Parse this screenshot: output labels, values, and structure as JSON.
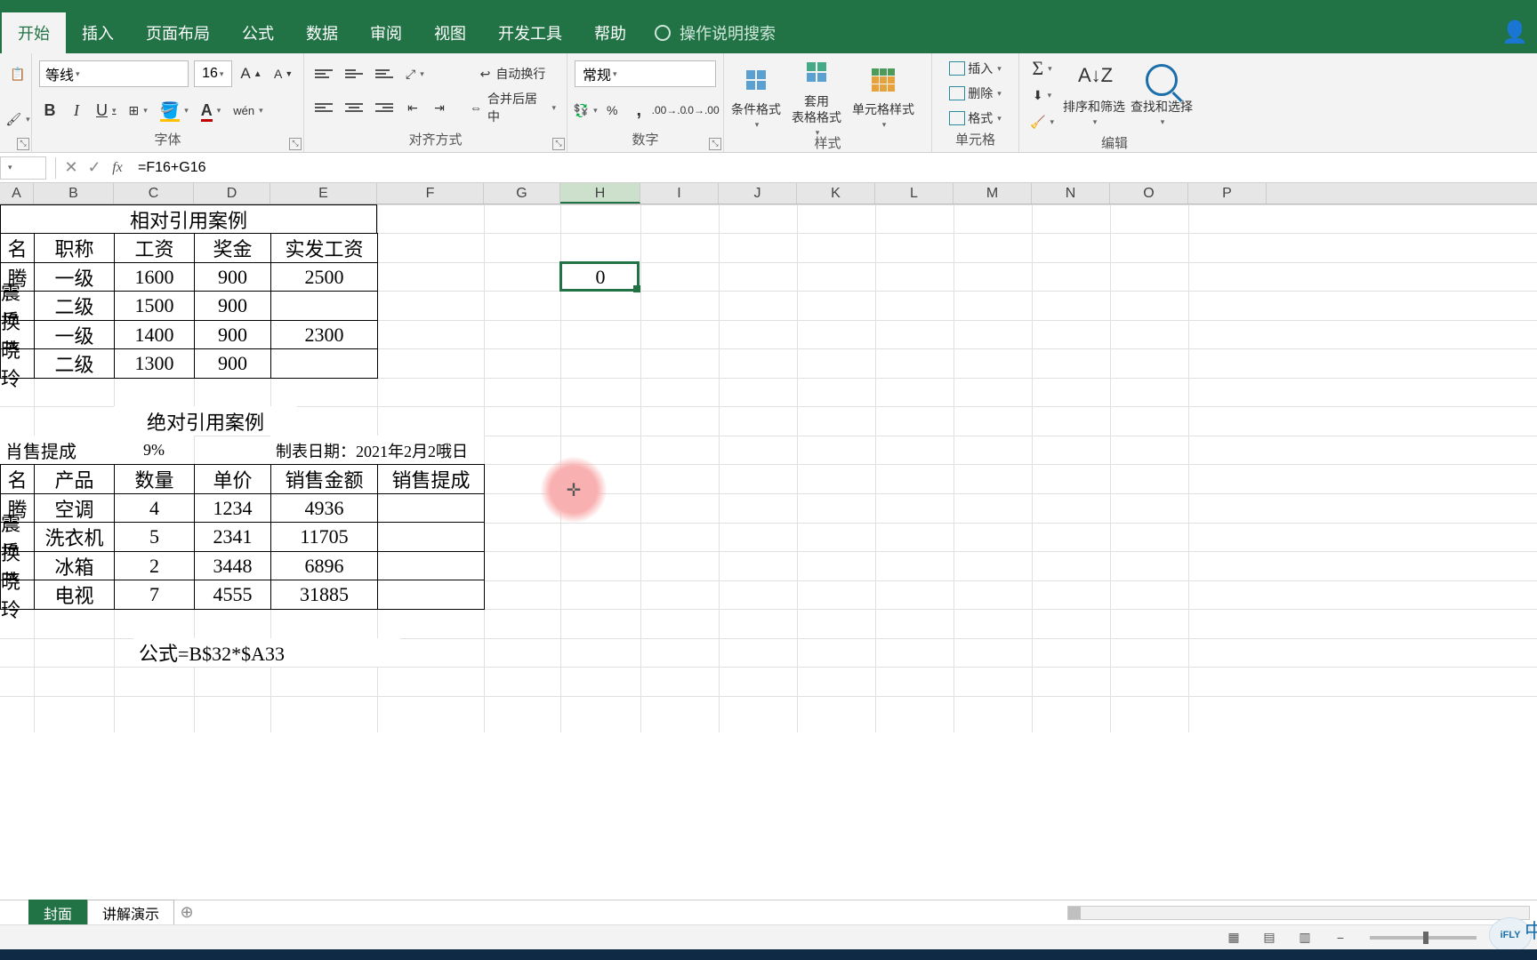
{
  "colors": {
    "brand": "#217346",
    "accent_fill": "#ffc000",
    "accent_font": "#c00000"
  },
  "ribbon": {
    "tabs": [
      "开始",
      "插入",
      "页面布局",
      "公式",
      "数据",
      "审阅",
      "视图",
      "开发工具",
      "帮助"
    ],
    "tellme": "操作说明搜索",
    "font": {
      "name": "等线",
      "size": "16",
      "grow": "A",
      "shrink": "A",
      "bold": "B",
      "italic": "I",
      "underline": "U",
      "pinyin": "wén",
      "group_label": "字体"
    },
    "align": {
      "wrap": "自动换行",
      "merge": "合并后居中",
      "group_label": "对齐方式"
    },
    "number": {
      "format": "常规",
      "percent": "%",
      "comma": ",",
      "group_label": "数字"
    },
    "styles": {
      "cond": "条件格式",
      "tablefmt_l1": "套用",
      "tablefmt_l2": "表格格式",
      "cellstyle": "单元格样式",
      "group_label": "样式"
    },
    "cells": {
      "insert": "插入",
      "delete": "删除",
      "format": "格式",
      "group_label": "单元格"
    },
    "editing": {
      "sort": "排序和筛选",
      "find": "查找和选择",
      "group_label": "编辑"
    }
  },
  "formula_bar": {
    "namebox": "",
    "formula": "=F16+G16"
  },
  "columns": [
    "A",
    "B",
    "C",
    "D",
    "E",
    "F",
    "G",
    "H",
    "I",
    "J",
    "K",
    "L",
    "M",
    "N",
    "O",
    "P"
  ],
  "selection": {
    "col": "H",
    "value": "0"
  },
  "table1": {
    "title": "相对引用案例",
    "headers": [
      "名",
      "职称",
      "工资",
      "奖金",
      "实发工资"
    ],
    "rows": [
      [
        "腾",
        "一级",
        "1600",
        "900",
        "2500"
      ],
      [
        "震岳",
        "二级",
        "1500",
        "900",
        ""
      ],
      [
        "换英",
        "一级",
        "1400",
        "900",
        "2300"
      ],
      [
        "晓玲",
        "二级",
        "1300",
        "900",
        ""
      ]
    ]
  },
  "table2": {
    "title": "绝对引用案例",
    "left_label": "肖售提成",
    "pct": "9%",
    "date_label": "制表日期：2021年2月2哦日",
    "headers": [
      "名",
      "产品",
      "数量",
      "单价",
      "销售金额",
      "销售提成"
    ],
    "rows": [
      [
        "腾",
        "空调",
        "4",
        "1234",
        "4936",
        ""
      ],
      [
        "震岳",
        "洗衣机",
        "5",
        "2341",
        "11705",
        ""
      ],
      [
        "换英",
        "冰箱",
        "2",
        "3448",
        "6896",
        ""
      ],
      [
        "晓玲",
        "电视",
        "7",
        "4555",
        "31885",
        ""
      ]
    ],
    "formula_note": "公式=B$32*$A33"
  },
  "sheets": {
    "active": "封面",
    "other": "讲解演示"
  },
  "ime_badge": "iFLY",
  "ime_side": "中"
}
